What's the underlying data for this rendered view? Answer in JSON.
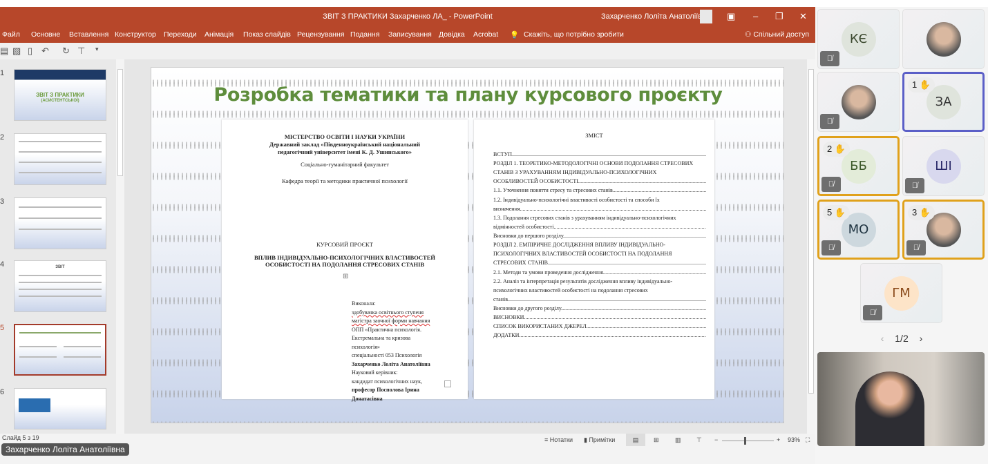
{
  "window": {
    "title": "ЗВІТ З ПРАКТИКИ Захарченко ЛА_ - PowerPoint",
    "user": "Захарченко Лоліта Анатоліївна"
  },
  "ribbon": {
    "tabs": [
      "Файл",
      "Основне",
      "Вставлення",
      "Конструктор",
      "Переходи",
      "Анімація",
      "Показ слайдів",
      "Рецензування",
      "Подання",
      "Записування",
      "Довідка",
      "Acrobat"
    ],
    "tell_me": "Скажіть, що потрібно зробити",
    "share": "Спільний доступ"
  },
  "thumbnails": {
    "numbers": [
      "1",
      "2",
      "3",
      "4",
      "5",
      "6"
    ],
    "selected": 5,
    "slide1_title": "ЗВІТ З ПРАКТИКИ",
    "slide1_subtitle": "(АСИСТЕНТСЬКОЇ)",
    "slide4_title": "ЗВІТ"
  },
  "slide": {
    "title": "Розробка тематики та плану курсового проєкту",
    "left_page": {
      "ministry": "МІСТЕРСТВО ОСВІТИ І НАУКИ УКРАЇНИ",
      "institution1": "Державний заклад «Південноукраїнський національний",
      "institution2": "педагогічний університет імені К. Д. Ушинського»",
      "faculty": "Соціально-гуманітарний факультет",
      "department": "Кафедра теорії та методики практичної психології",
      "doc_type": "КУРСОВИЙ ПРОЄКТ",
      "topic1": "ВПЛИВ ІНДИВІДУАЛЬНО-ПСИХОЛОГІЧНИХ ВЛАСТИВОСТЕЙ",
      "topic2": "ОСОБИСТОСТІ НА ПОДОЛАННЯ СТРЕСОВИХ СТАНІВ",
      "author_lines": [
        "Виконала:",
        "здобувачка освітнього ступеня",
        "магістра заочної форми навчання",
        "ОПП «Практична психологія.",
        "Екстремальна та кризова",
        "психологія»",
        "спеціальності 053 Психологія",
        "Захарченко Лоліта Анатоліївна",
        "Науковий керівник:",
        "кандидат психологічних наук,",
        "професор Посполова Ірина",
        "Донатасівна"
      ]
    },
    "right_page": {
      "heading": "ЗМІСТ",
      "toc": [
        "ВСТУП",
        "РОЗДІЛ 1. ТЕОРЕТИКО-МЕТОДОЛОГІЧНІ ОСНОВИ ПОДОЛАННЯ СТРЕСОВИХ",
        "СТАНІВ З УРАХУВАННЯМ ІНДИВІДУАЛЬНО-ПСИХОЛОГІЧНИХ",
        "ОСОБЛИВОСТЕЙ ОСОБИСТОСТІ",
        "1.1. Уточнення поняття стресу та стресових станів",
        "1.2. Індивідуально-психологічні властивості особистості та способи їх",
        "визначення",
        "1.3. Подолання стресових станів з урахуванням індивідуально-психологічних",
        "відмінностей особистості",
        "Висновки до першого розділу",
        "РОЗДІЛ 2. ЕМПІРИЧНЕ ДОСЛІДЖЕННЯ ВПЛИВУ ІНДИВІДУАЛЬНО-",
        "ПСИХОЛОГІЧНИХ ВЛАСТИВОСТЕЙ  ОСОБИСТОСТІ НА ПОДОЛАННЯ",
        "СТРЕСОВИХ СТАНІВ",
        "2.1. Методи та умови проведення дослідження",
        "2.2. Аналіз та інтерпретація результатів дослідження впливу індивідуально-",
        "психологічних властивостей особистості на подолання стресових",
        "станів",
        "Висновки до другого розділу",
        "ВИСНОВКИ",
        "СПИСОК ВИКОРИСТАНИХ ДЖЕРЕЛ",
        "ДОДАТКИ"
      ]
    }
  },
  "statusbar": {
    "slide_info": "Слайд 5 з 19",
    "notes": "Нотатки",
    "comments": "Примітки",
    "zoom": "93%",
    "zoom_percent": 93
  },
  "presenter_tag": "Захарченко Лоліта Анатоліївна",
  "participants": [
    {
      "initials": "КЄ",
      "muted": true,
      "hand": null
    },
    {
      "initials": "",
      "photo": true,
      "muted": false,
      "hand": null
    },
    {
      "initials": "",
      "photo": true,
      "muted": true,
      "hand": null
    },
    {
      "initials": "ЗА",
      "muted": false,
      "hand": "1",
      "active": true
    },
    {
      "initials": "ББ",
      "muted": true,
      "hand": "2"
    },
    {
      "initials": "ШІ",
      "muted": true,
      "hand": null
    },
    {
      "initials": "МО",
      "muted": true,
      "hand": "5"
    },
    {
      "initials": "",
      "photo": true,
      "muted": true,
      "hand": "3"
    },
    {
      "initials": "ГМ",
      "muted": true,
      "hand": null
    }
  ],
  "pager": "1/2",
  "colors": {
    "titlebar": "#b7472a",
    "slide_title": "#5e8d3c",
    "raised_hand_border": "#e0a11b",
    "active_speaker": "#5b5fc7"
  }
}
